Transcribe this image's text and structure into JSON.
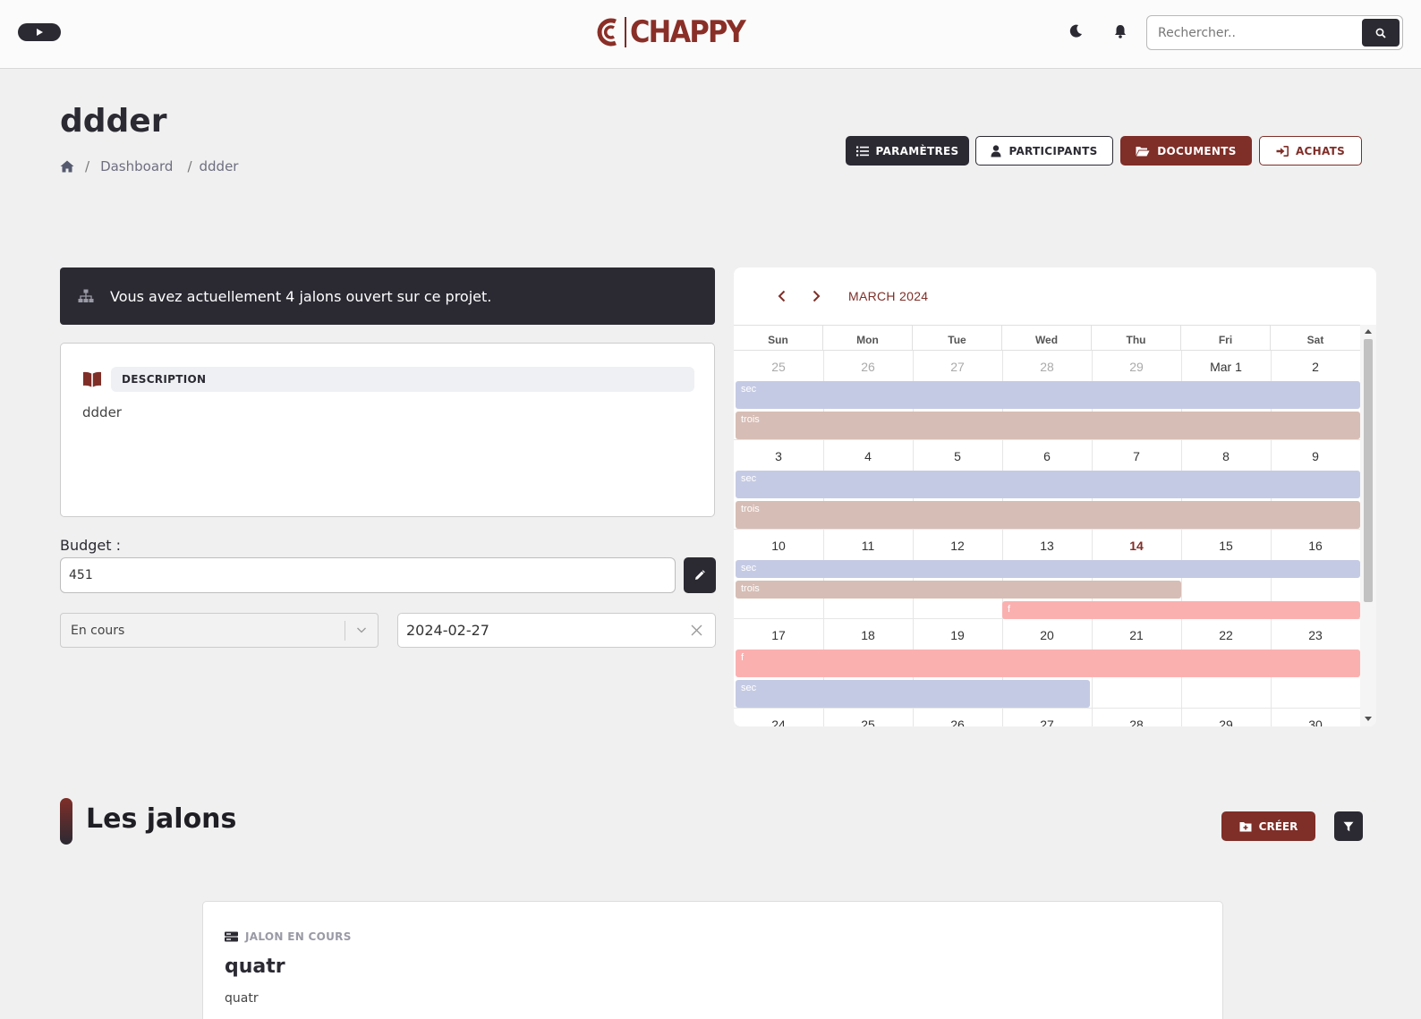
{
  "header": {
    "logo_text": "CHAPPY",
    "search_placeholder": "Rechercher.."
  },
  "page": {
    "title": "ddder",
    "breadcrumb": [
      "Dashboard",
      "ddder"
    ]
  },
  "actions": {
    "parametres": "PARAMÈTRES",
    "participants": "PARTICIPANTS",
    "documents": "DOCUMENTS",
    "achats": "ACHATS"
  },
  "alert": {
    "text": "Vous avez actuellement 4 jalons ouvert sur ce projet."
  },
  "description": {
    "label": "DESCRIPTION",
    "text": "ddder"
  },
  "budget": {
    "label": "Budget :",
    "value": "451"
  },
  "status": {
    "selected": "En cours"
  },
  "date": {
    "value": "2024-02-27"
  },
  "calendar": {
    "month_label": "MARCH 2024",
    "weekdays": [
      "Sun",
      "Mon",
      "Tue",
      "Wed",
      "Thu",
      "Fri",
      "Sat"
    ],
    "weeks": [
      [
        "25",
        "26",
        "27",
        "28",
        "29",
        "Mar 1",
        "2"
      ],
      [
        "3",
        "4",
        "5",
        "6",
        "7",
        "8",
        "9"
      ],
      [
        "10",
        "11",
        "12",
        "13",
        "14",
        "15",
        "16"
      ],
      [
        "17",
        "18",
        "19",
        "20",
        "21",
        "22",
        "23"
      ],
      [
        "24",
        "25",
        "26",
        "27",
        "28",
        "29",
        "30"
      ]
    ],
    "events": {
      "sec": "sec",
      "trois": "trois",
      "f": "f"
    }
  },
  "jalons": {
    "title": "Les jalons",
    "create_label": "CRÉER",
    "card": {
      "tag": "JALON EN COURS",
      "title": "quatr",
      "description": "quatr"
    }
  }
}
